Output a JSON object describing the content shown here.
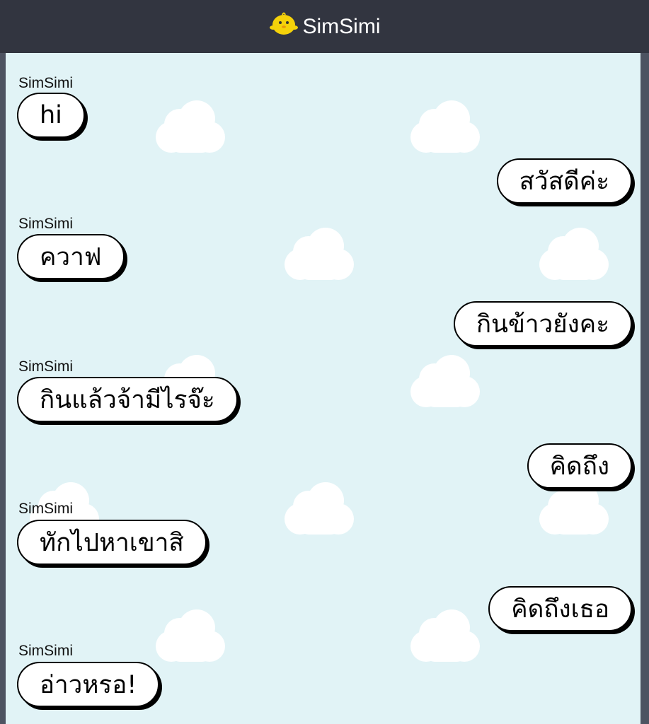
{
  "header": {
    "title": "SimSimi",
    "logo_icon": "simsimi-chick-icon"
  },
  "colors": {
    "header_bg": "#323540",
    "chat_bg": "#e1f3f6",
    "bubble_bg": "#ffffff",
    "bubble_border": "#000000",
    "logo": "#f5d20a"
  },
  "messages": [
    {
      "sender": "SimSimi",
      "text": "hi"
    },
    {
      "sender": "",
      "text": "สวัสดีค่ะ"
    },
    {
      "sender": "SimSimi",
      "text": "ควาฟ"
    },
    {
      "sender": "",
      "text": "กินข้าวยังคะ"
    },
    {
      "sender": "SimSimi",
      "text": "กินแล้วจ้ามีไรจ๊ะ"
    },
    {
      "sender": "",
      "text": "คิดถึง"
    },
    {
      "sender": "SimSimi",
      "text": "ทักไปหาเขาสิ"
    },
    {
      "sender": "",
      "text": "คิดถึงเธอ"
    },
    {
      "sender": "SimSimi",
      "text": "อ่าวหรอ!"
    }
  ]
}
